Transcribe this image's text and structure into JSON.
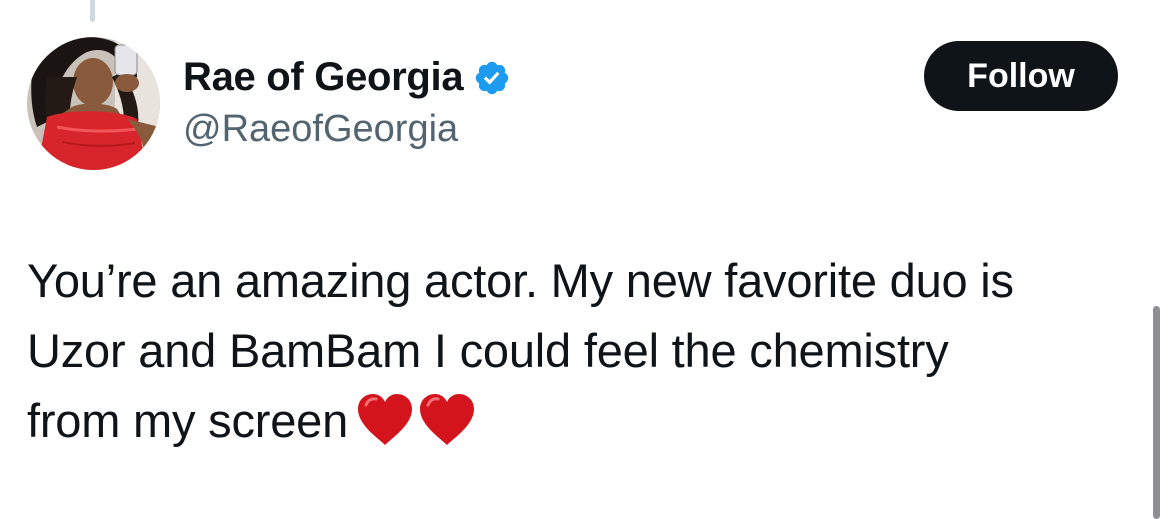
{
  "tweet": {
    "author": {
      "display_name": "Rae of Georgia",
      "handle": "@RaeofGeorgia",
      "verified": true,
      "verified_icon": "verified-badge-icon",
      "avatar_icon": "avatar"
    },
    "follow_label": "Follow",
    "text_lines": [
      "You’re an amazing actor. My new favorite duo is",
      "Uzor and BamBam I could feel the chemistry",
      "from my screen"
    ],
    "emoji": [
      "❤️",
      "❤️"
    ]
  },
  "colors": {
    "text_primary": "#0f1419",
    "text_secondary": "#536471",
    "verified_blue": "#1d9bf0",
    "follow_button_bg": "#0f1419",
    "heart_red": "#d4141c"
  }
}
